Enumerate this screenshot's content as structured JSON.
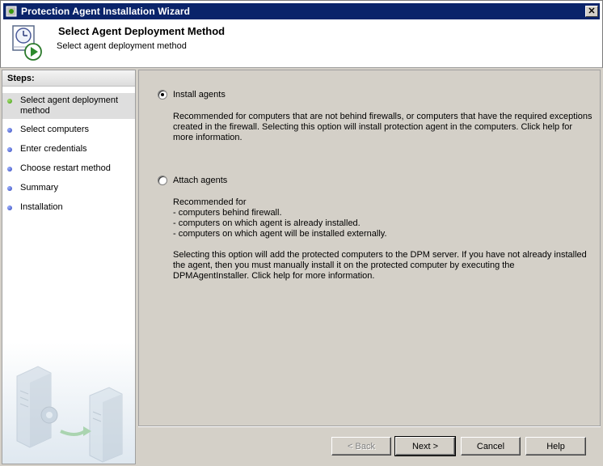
{
  "window": {
    "title": "Protection Agent Installation Wizard",
    "close_glyph": "✕"
  },
  "header": {
    "title": "Select Agent Deployment Method",
    "subtitle": "Select agent deployment method",
    "icon": "clock-play-icon"
  },
  "steps": {
    "label": "Steps:",
    "items": [
      {
        "label": "Select agent deployment method",
        "status": "current",
        "color": "#3a9a10"
      },
      {
        "label": "Select computers",
        "status": "pending",
        "color": "#2c3fb8"
      },
      {
        "label": "Enter credentials",
        "status": "pending",
        "color": "#2c3fb8"
      },
      {
        "label": "Choose restart method",
        "status": "pending",
        "color": "#2c3fb8"
      },
      {
        "label": "Summary",
        "status": "pending",
        "color": "#2c3fb8"
      },
      {
        "label": "Installation",
        "status": "pending",
        "color": "#2c3fb8"
      }
    ]
  },
  "options": {
    "install": {
      "label": "Install agents",
      "selected": true,
      "description": "Recommended for computers that are not behind firewalls, or computers that have the required exceptions\ncreated in the firewall. Selecting this option will install protection agent in the computers. Click help for\nmore information."
    },
    "attach": {
      "label": "Attach agents",
      "selected": false,
      "description": "Recommended for\n- computers behind firewall.\n- computers on which agent is already installed.\n- computers on which agent will be installed externally.",
      "description2": "Selecting this option will add the protected computers to the DPM server. If you have not already installed\nthe agent, then you must manually install it on the protected computer by executing the\nDPMAgentInstaller. Click help for more information."
    }
  },
  "buttons": {
    "back": "< Back",
    "next": "Next >",
    "cancel": "Cancel",
    "help": "Help"
  }
}
